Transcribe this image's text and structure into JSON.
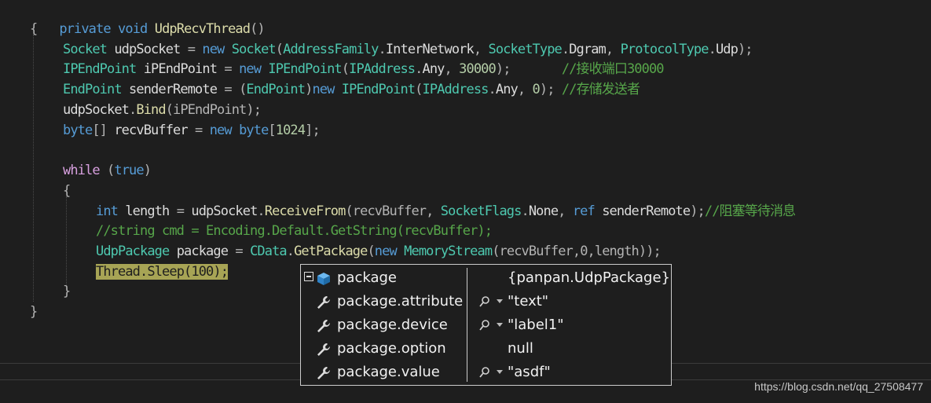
{
  "code": {
    "l1": {
      "kw1": "private",
      "kw2": "void",
      "name": "UdpRecvThread",
      "rest": "()"
    },
    "l2": {
      "b": "{"
    },
    "l3": {
      "t1": "Socket",
      "v": " udpSocket",
      "eq": " = ",
      "nw": "new",
      "sp": " ",
      "t2": "Socket",
      "p1": "(",
      "t3": "AddressFamily",
      "d1": ".",
      "a1": "InterNetwork",
      "c1": ", ",
      "t4": "SocketType",
      "d2": ".",
      "a2": "Dgram",
      "c2": ", ",
      "t5": "ProtocolType",
      "d3": ".",
      "a3": "Udp",
      "end": ");"
    },
    "l4": {
      "t1": "IPEndPoint",
      "v": " iPEndPoint",
      "eq": " = ",
      "nw": "new",
      "sp": " ",
      "t2": "IPEndPoint",
      "p1": "(",
      "t3": "IPAddress",
      "d1": ".",
      "a1": "Any",
      "c1": ", ",
      "n": "30000",
      "end": ");",
      "gap": "       ",
      "cm": "//接收端口30000"
    },
    "l5": {
      "t1": "EndPoint",
      "v": " senderRemote",
      "eq": " = ",
      "p0": "(",
      "t2": "EndPoint",
      "p0e": ")",
      "nw": "new",
      "sp": " ",
      "t3": "IPEndPoint",
      "p1": "(",
      "t4": "IPAddress",
      "d1": ".",
      "a1": "Any",
      "c1": ", ",
      "n": "0",
      "end": ");",
      "gap": " ",
      "cm": "//存储发送者"
    },
    "l6": {
      "v": "udpSocket",
      "d": ".",
      "m": "Bind",
      "rest": "(iPEndPoint);"
    },
    "l7": {
      "kw": "byte",
      "br": "[]",
      "v": " recvBuffer",
      "eq": " = ",
      "nw": "new",
      "sp": " ",
      "kw2": "byte",
      "p1": "[",
      "n": "1024",
      "end": "];"
    },
    "l9": {
      "kw": "while",
      "sp": " ",
      "p1": "(",
      "kw2": "true",
      "p2": ")"
    },
    "l10": {
      "b": "{"
    },
    "l11": {
      "kw": "int",
      "v": " length",
      "eq": " = ",
      "o": "udpSocket",
      "d": ".",
      "m": "ReceiveFrom",
      "p1": "(recvBuffer, ",
      "t": "SocketFlags",
      "d2": ".",
      "a": "None",
      "c": ", ",
      "kw2": "ref",
      "v2": " senderRemote",
      "end": ");",
      "cm": "//阻塞等待消息"
    },
    "l12": {
      "cm": "//string cmd = Encoding.Default.GetString(recvBuffer);"
    },
    "l13": {
      "t": "UdpPackage",
      "v": " package",
      "eq": " = ",
      "t2": "CData",
      "d": ".",
      "m": "GetPackage",
      "p1": "(",
      "nw": "new",
      "sp": " ",
      "t3": "MemoryStream",
      "rest": "(recvBuffer,0,length));"
    },
    "l14": {
      "t": "Thread",
      "d": ".",
      "m": "Sleep",
      "p1": "(",
      "n": "100",
      "end": ");"
    },
    "l15": {
      "b": "}"
    },
    "l16": {
      "b": "}"
    }
  },
  "datatip": {
    "rows": [
      {
        "name": "package",
        "value": "{panpan.UdpPackage}"
      },
      {
        "name": "package.attribute",
        "value": "\"text\""
      },
      {
        "name": "package.device",
        "value": "\"label1\""
      },
      {
        "name": "package.option",
        "value": "null"
      },
      {
        "name": "package.value",
        "value": "\"asdf\""
      }
    ]
  },
  "watermark": "https://blog.csdn.net/qq_27508477",
  "colors": {
    "keyword": "#569cd6",
    "type": "#4ec9b0",
    "method": "#dcdcaa",
    "comment": "#57a64a",
    "control": "#d8a0df",
    "highlight": "#a7a455"
  }
}
